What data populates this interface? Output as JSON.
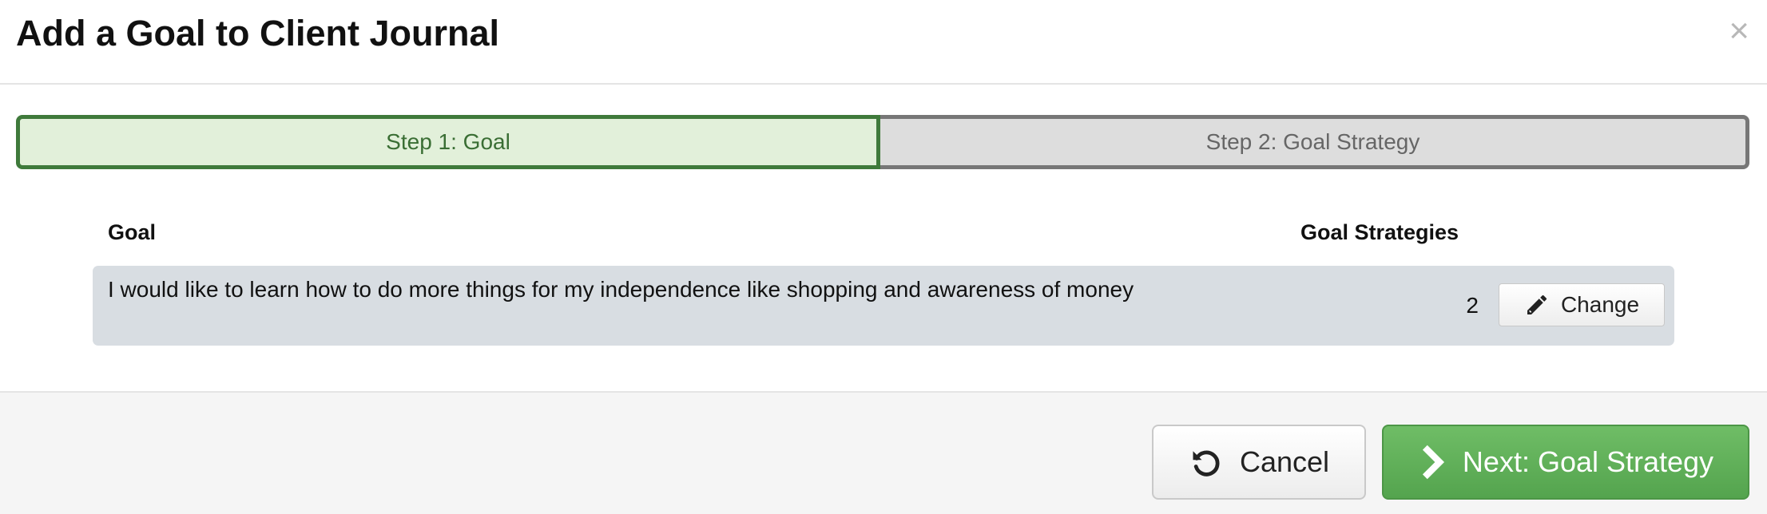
{
  "dialog": {
    "title": "Add a Goal to Client Journal",
    "close_icon": "close-icon",
    "close_glyph": "×"
  },
  "steps": [
    {
      "label": "Step 1: Goal",
      "active": true
    },
    {
      "label": "Step 2: Goal Strategy",
      "active": false
    }
  ],
  "table": {
    "columns": [
      "Goal",
      "Goal Strategies"
    ],
    "rows": [
      {
        "goal": "I would like to learn how to do more things for my independence like shopping and awareness of money",
        "strategies": "2",
        "action_label": "Change",
        "action_icon": "pencil-icon"
      }
    ]
  },
  "footer": {
    "cancel_label": "Cancel",
    "cancel_icon": "undo-icon",
    "next_label": "Next: Goal Strategy",
    "next_icon": "chevron-right-icon"
  },
  "colors": {
    "active_step_bg": "#e2f0da",
    "active_step_border": "#3f7a3b",
    "inactive_step_bg": "#dddddd",
    "primary_button": "#5cb85c"
  }
}
